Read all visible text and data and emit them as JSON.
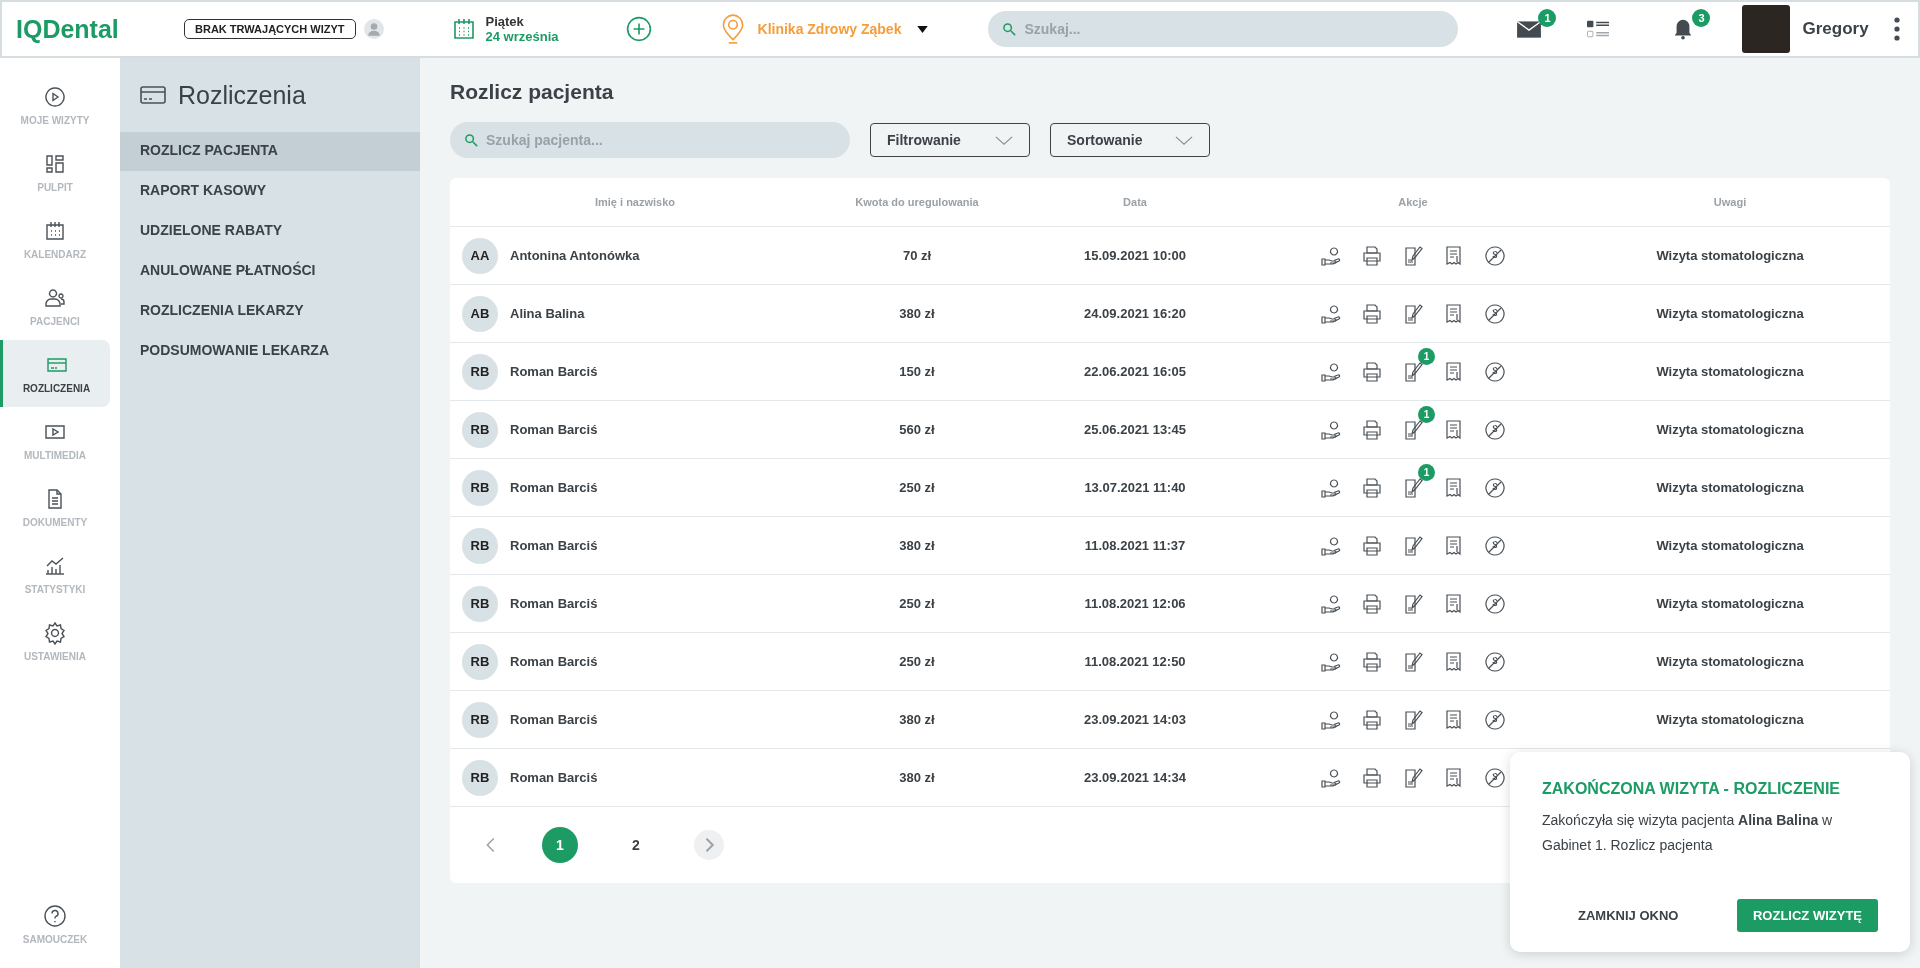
{
  "header": {
    "logo": "IQDental",
    "visit_status": "BRAK TRWAJĄCYCH WIZYT",
    "date": {
      "weekday": "Piątek",
      "day": "24 września"
    },
    "clinic": "Klinika Zdrowy Ząbek",
    "search": {
      "placeholder": "Szukaj..."
    },
    "messages_badge": "1",
    "notifications_badge": "3",
    "user": "Gregory"
  },
  "nav": [
    {
      "label": "MOJE WIZYTY",
      "selected": false
    },
    {
      "label": "PULPIT",
      "selected": false
    },
    {
      "label": "KALENDARZ",
      "selected": false
    },
    {
      "label": "PACJENCI",
      "selected": false
    },
    {
      "label": "ROZLICZENIA",
      "selected": true
    },
    {
      "label": "MULTIMEDIA",
      "selected": false
    },
    {
      "label": "DOKUMENTY",
      "selected": false
    },
    {
      "label": "STATYSTYKI",
      "selected": false
    },
    {
      "label": "USTAWIENIA",
      "selected": false
    }
  ],
  "nav_footer": {
    "label": "SAMOUCZEK"
  },
  "submenu": {
    "title": "Rozliczenia",
    "items": [
      {
        "label": "ROZLICZ PACJENTA",
        "selected": true
      },
      {
        "label": "RAPORT KASOWY",
        "selected": false
      },
      {
        "label": "UDZIELONE RABATY",
        "selected": false
      },
      {
        "label": "ANULOWANE PŁATNOŚCI",
        "selected": false
      },
      {
        "label": "ROZLICZENIA LEKARZY",
        "selected": false
      },
      {
        "label": "PODSUMOWANIE LEKARZA",
        "selected": false
      }
    ]
  },
  "page": {
    "title": "Rozlicz pacjenta",
    "search": {
      "placeholder": "Szukaj pacjenta..."
    },
    "filter": "Filtrowanie",
    "sort": "Sortowanie"
  },
  "table": {
    "columns": [
      "Imię i nazwisko",
      "Kwota do uregulowania",
      "Data",
      "Akcje",
      "Uwagi"
    ],
    "rows": [
      {
        "initials": "AA",
        "name": "Antonina Antonówka",
        "amount": "70 zł",
        "date": "15.09.2021 10:00",
        "remarks": "Wizyta stomatologiczna"
      },
      {
        "initials": "AB",
        "name": "Alina Balina",
        "amount": "380 zł",
        "date": "24.09.2021 16:20",
        "remarks": "Wizyta stomatologiczna"
      },
      {
        "initials": "RB",
        "name": "Roman Barciś",
        "amount": "150 zł",
        "date": "22.06.2021 16:05",
        "note_badge": "1",
        "remarks": "Wizyta stomatologiczna"
      },
      {
        "initials": "RB",
        "name": "Roman Barciś",
        "amount": "560 zł",
        "date": "25.06.2021 13:45",
        "note_badge": "1",
        "remarks": "Wizyta stomatologiczna"
      },
      {
        "initials": "RB",
        "name": "Roman Barciś",
        "amount": "250 zł",
        "date": "13.07.2021 11:40",
        "note_badge": "1",
        "remarks": "Wizyta stomatologiczna"
      },
      {
        "initials": "RB",
        "name": "Roman Barciś",
        "amount": "380 zł",
        "date": "11.08.2021 11:37",
        "remarks": "Wizyta stomatologiczna"
      },
      {
        "initials": "RB",
        "name": "Roman Barciś",
        "amount": "250 zł",
        "date": "11.08.2021 12:06",
        "remarks": "Wizyta stomatologiczna"
      },
      {
        "initials": "RB",
        "name": "Roman Barciś",
        "amount": "250 zł",
        "date": "11.08.2021 12:50",
        "remarks": "Wizyta stomatologiczna"
      },
      {
        "initials": "RB",
        "name": "Roman Barciś",
        "amount": "380 zł",
        "date": "23.09.2021 14:03",
        "remarks": "Wizyta stomatologiczna"
      },
      {
        "initials": "RB",
        "name": "Roman Barciś",
        "amount": "380 zł",
        "date": "23.09.2021 14:34"
      }
    ]
  },
  "pagination": {
    "pages": [
      {
        "label": "1",
        "selected": true
      },
      {
        "label": "2",
        "selected": false
      }
    ]
  },
  "toast": {
    "title": "ZAKOŃCZONA WIZYTA - ROZLICZENIE",
    "message": "Zakończyła się wizyta pacjenta **Alina Balina** w Gabinet 1. Rozlicz pacjenta",
    "buttons": [
      "ZAMKNIJ OKNO",
      "ROZLICZ WIZYTĘ"
    ]
  }
}
